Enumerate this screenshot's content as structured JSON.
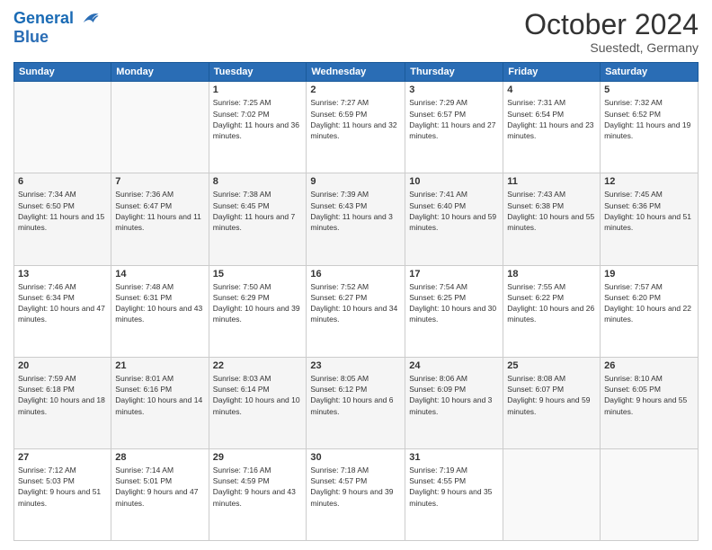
{
  "header": {
    "logo_line1": "General",
    "logo_line2": "Blue",
    "month": "October 2024",
    "location": "Suestedt, Germany"
  },
  "weekdays": [
    "Sunday",
    "Monday",
    "Tuesday",
    "Wednesday",
    "Thursday",
    "Friday",
    "Saturday"
  ],
  "weeks": [
    [
      {
        "day": "",
        "info": ""
      },
      {
        "day": "",
        "info": ""
      },
      {
        "day": "1",
        "info": "Sunrise: 7:25 AM\nSunset: 7:02 PM\nDaylight: 11 hours and 36 minutes."
      },
      {
        "day": "2",
        "info": "Sunrise: 7:27 AM\nSunset: 6:59 PM\nDaylight: 11 hours and 32 minutes."
      },
      {
        "day": "3",
        "info": "Sunrise: 7:29 AM\nSunset: 6:57 PM\nDaylight: 11 hours and 27 minutes."
      },
      {
        "day": "4",
        "info": "Sunrise: 7:31 AM\nSunset: 6:54 PM\nDaylight: 11 hours and 23 minutes."
      },
      {
        "day": "5",
        "info": "Sunrise: 7:32 AM\nSunset: 6:52 PM\nDaylight: 11 hours and 19 minutes."
      }
    ],
    [
      {
        "day": "6",
        "info": "Sunrise: 7:34 AM\nSunset: 6:50 PM\nDaylight: 11 hours and 15 minutes."
      },
      {
        "day": "7",
        "info": "Sunrise: 7:36 AM\nSunset: 6:47 PM\nDaylight: 11 hours and 11 minutes."
      },
      {
        "day": "8",
        "info": "Sunrise: 7:38 AM\nSunset: 6:45 PM\nDaylight: 11 hours and 7 minutes."
      },
      {
        "day": "9",
        "info": "Sunrise: 7:39 AM\nSunset: 6:43 PM\nDaylight: 11 hours and 3 minutes."
      },
      {
        "day": "10",
        "info": "Sunrise: 7:41 AM\nSunset: 6:40 PM\nDaylight: 10 hours and 59 minutes."
      },
      {
        "day": "11",
        "info": "Sunrise: 7:43 AM\nSunset: 6:38 PM\nDaylight: 10 hours and 55 minutes."
      },
      {
        "day": "12",
        "info": "Sunrise: 7:45 AM\nSunset: 6:36 PM\nDaylight: 10 hours and 51 minutes."
      }
    ],
    [
      {
        "day": "13",
        "info": "Sunrise: 7:46 AM\nSunset: 6:34 PM\nDaylight: 10 hours and 47 minutes."
      },
      {
        "day": "14",
        "info": "Sunrise: 7:48 AM\nSunset: 6:31 PM\nDaylight: 10 hours and 43 minutes."
      },
      {
        "day": "15",
        "info": "Sunrise: 7:50 AM\nSunset: 6:29 PM\nDaylight: 10 hours and 39 minutes."
      },
      {
        "day": "16",
        "info": "Sunrise: 7:52 AM\nSunset: 6:27 PM\nDaylight: 10 hours and 34 minutes."
      },
      {
        "day": "17",
        "info": "Sunrise: 7:54 AM\nSunset: 6:25 PM\nDaylight: 10 hours and 30 minutes."
      },
      {
        "day": "18",
        "info": "Sunrise: 7:55 AM\nSunset: 6:22 PM\nDaylight: 10 hours and 26 minutes."
      },
      {
        "day": "19",
        "info": "Sunrise: 7:57 AM\nSunset: 6:20 PM\nDaylight: 10 hours and 22 minutes."
      }
    ],
    [
      {
        "day": "20",
        "info": "Sunrise: 7:59 AM\nSunset: 6:18 PM\nDaylight: 10 hours and 18 minutes."
      },
      {
        "day": "21",
        "info": "Sunrise: 8:01 AM\nSunset: 6:16 PM\nDaylight: 10 hours and 14 minutes."
      },
      {
        "day": "22",
        "info": "Sunrise: 8:03 AM\nSunset: 6:14 PM\nDaylight: 10 hours and 10 minutes."
      },
      {
        "day": "23",
        "info": "Sunrise: 8:05 AM\nSunset: 6:12 PM\nDaylight: 10 hours and 6 minutes."
      },
      {
        "day": "24",
        "info": "Sunrise: 8:06 AM\nSunset: 6:09 PM\nDaylight: 10 hours and 3 minutes."
      },
      {
        "day": "25",
        "info": "Sunrise: 8:08 AM\nSunset: 6:07 PM\nDaylight: 9 hours and 59 minutes."
      },
      {
        "day": "26",
        "info": "Sunrise: 8:10 AM\nSunset: 6:05 PM\nDaylight: 9 hours and 55 minutes."
      }
    ],
    [
      {
        "day": "27",
        "info": "Sunrise: 7:12 AM\nSunset: 5:03 PM\nDaylight: 9 hours and 51 minutes."
      },
      {
        "day": "28",
        "info": "Sunrise: 7:14 AM\nSunset: 5:01 PM\nDaylight: 9 hours and 47 minutes."
      },
      {
        "day": "29",
        "info": "Sunrise: 7:16 AM\nSunset: 4:59 PM\nDaylight: 9 hours and 43 minutes."
      },
      {
        "day": "30",
        "info": "Sunrise: 7:18 AM\nSunset: 4:57 PM\nDaylight: 9 hours and 39 minutes."
      },
      {
        "day": "31",
        "info": "Sunrise: 7:19 AM\nSunset: 4:55 PM\nDaylight: 9 hours and 35 minutes."
      },
      {
        "day": "",
        "info": ""
      },
      {
        "day": "",
        "info": ""
      }
    ]
  ]
}
